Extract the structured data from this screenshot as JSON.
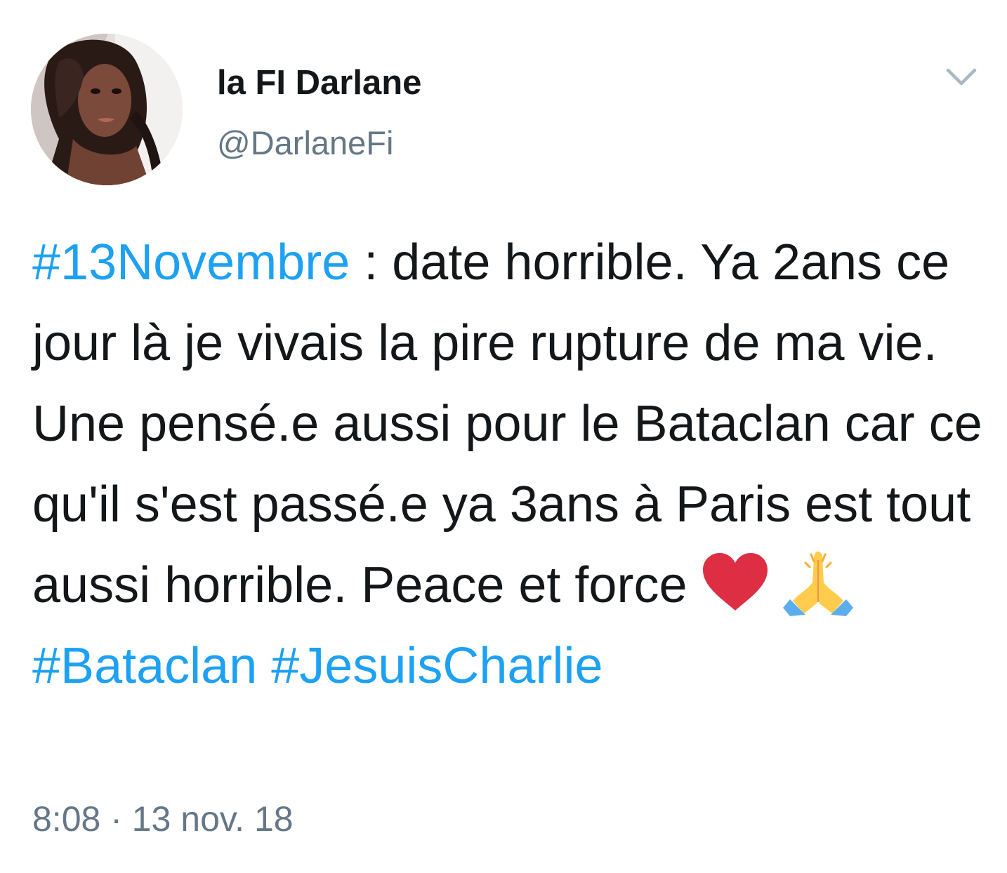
{
  "author": {
    "display_name": "la FI Darlane",
    "handle": "@DarlaneFi"
  },
  "tweet": {
    "hashtag_1": "#13Novembre",
    "text_1": " : date horrible. Ya 2ans ce jour là je vivais la pire rupture de ma vie. Une pensé.e aussi pour le Bataclan car ce qu'il s'est passé.e ya 3ans à Paris est tout aussi horrible. Peace et force ",
    "emoji_1": "red-heart",
    "emoji_2": "folded-hands",
    "hashtag_2": "#Bataclan",
    "hashtag_3": "#JesuisCharlie"
  },
  "timestamp": "8:08 · 13 nov. 18",
  "icons": {
    "menu": "chevron-down-icon",
    "avatar": "profile-photo"
  },
  "colors": {
    "hashtag": "#1da1f2",
    "secondary_text": "#657786",
    "primary_text": "#14171a",
    "heart": "#e0245e"
  }
}
